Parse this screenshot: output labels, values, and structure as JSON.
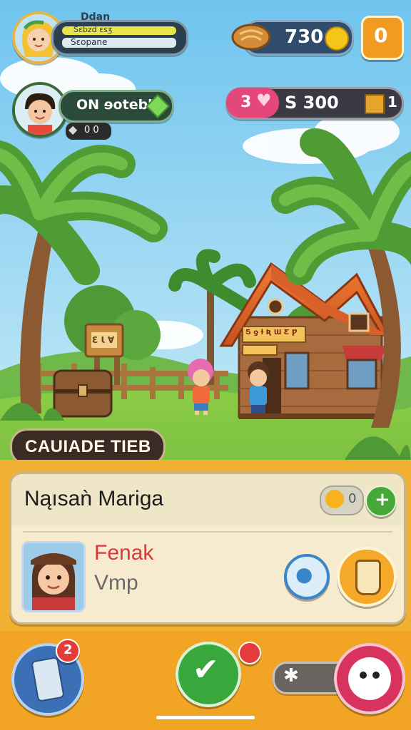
{
  "hud": {
    "player_name": "Ddan",
    "player_sub": "Sɛbzd ɛsʒ",
    "player_tag": "Sɛopane",
    "coins": "730",
    "menu_icon": "0"
  },
  "friend": {
    "status": "ON ɘotebl",
    "count": "0 0"
  },
  "resources": {
    "hearts": "3",
    "gold": "S 300",
    "crates": "1"
  },
  "scene": {
    "sign_text": "Ɛ Ɩ Ɐ",
    "house_sign": "Ƽ ƍ ƚ Ʀ Ɯ Ƹ Ƿ"
  },
  "banner": {
    "label": "CAUIADE TIEB"
  },
  "card": {
    "title": "Nąısaǹ Mariga",
    "counter": "0",
    "npc_name": "Fenak",
    "npc_sub": "Vmp"
  },
  "bottom": {
    "badge_count": "2"
  },
  "colors": {
    "sky": "#7ec9ee",
    "grass": "#7cc043",
    "accent_orange": "#f2a524",
    "confirm_green": "#38a83c",
    "pink": "#e4477a"
  }
}
